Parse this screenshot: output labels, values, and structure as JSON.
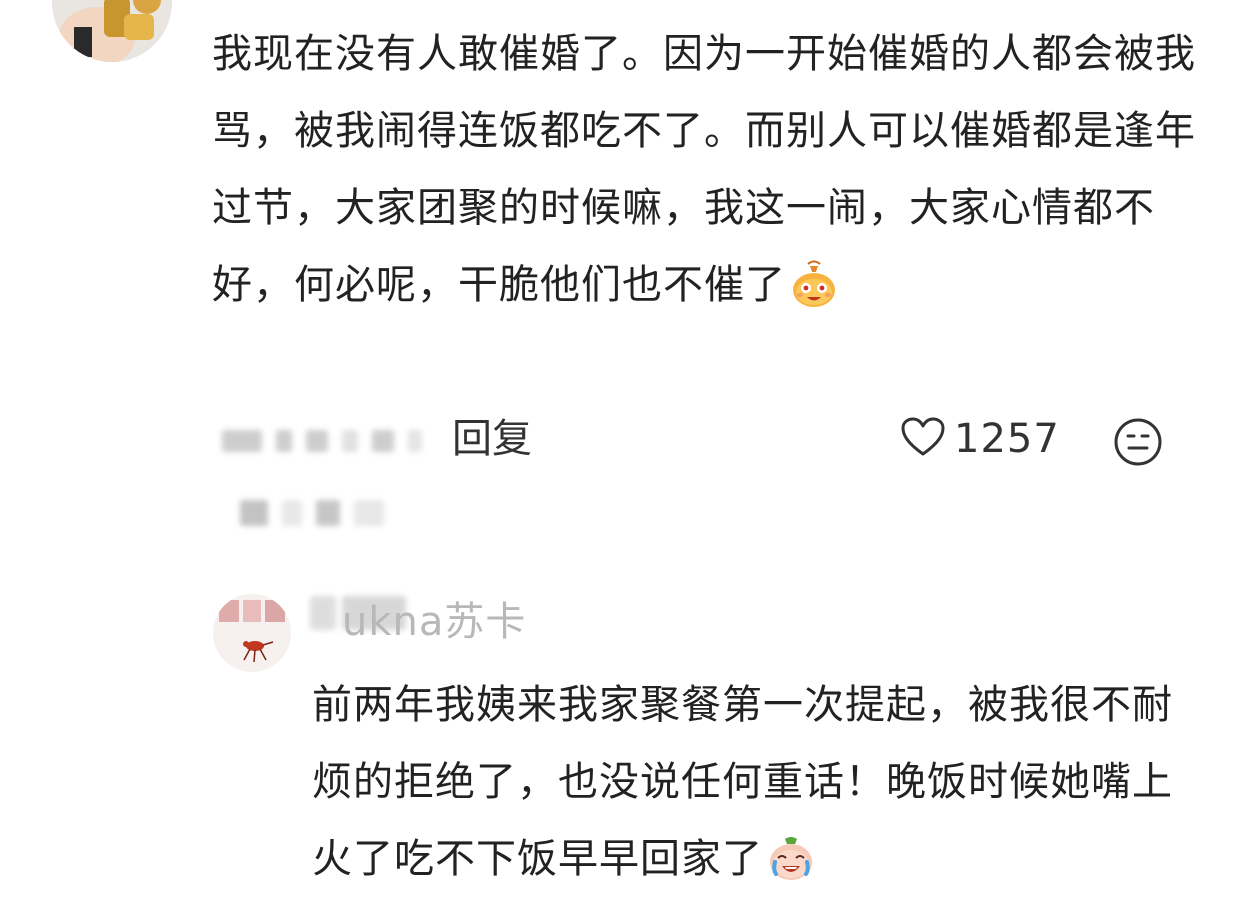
{
  "comment_main": {
    "text": "我现在没有人敢催婚了。因为一开始催婚的人都会被我骂，被我闹得连饭都吃不了。而别人可以催婚都是逢年过节，大家团聚的时候嘛，我这一闹，大家心情都不好，何必呢，干脆他们也不催了",
    "emoji_icon": "money-bag-smile-emoji-icon"
  },
  "actions": {
    "reply_label": "回复",
    "like_count": "1257",
    "like_icon": "heart-outline-icon",
    "react_icon": "smiley-face-icon"
  },
  "reply": {
    "username_visible": "ukna苏卡",
    "text": "前两年我姨来我家聚餐第一次提起，被我很不耐烦的拒绝了，也没说任何重话！晚饭时候她嘴上火了吃不下饭早早回家了",
    "emoji_icon": "crying-laughing-emoji-icon"
  },
  "colors": {
    "text": "#222222",
    "muted": "#b8b8b8",
    "icon_stroke": "#333333"
  }
}
